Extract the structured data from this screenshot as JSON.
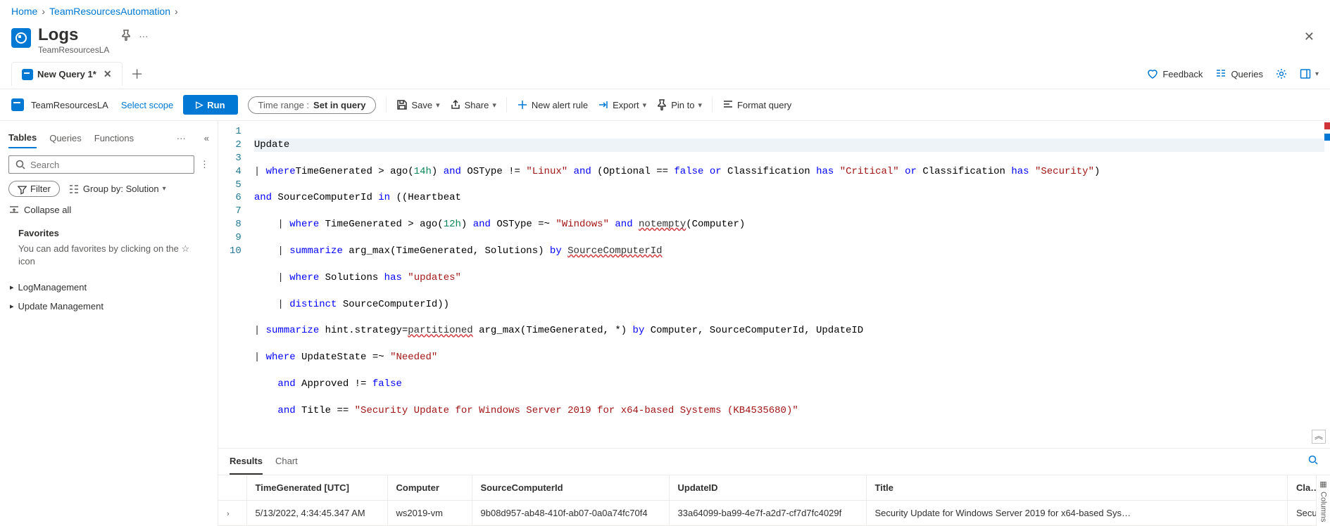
{
  "breadcrumb": {
    "home": "Home",
    "resource": "TeamResourcesAutomation"
  },
  "header": {
    "title": "Logs",
    "subtitle": "TeamResourcesLA"
  },
  "queryTabs": {
    "active": "New Query 1*"
  },
  "topRight": {
    "feedback": "Feedback",
    "queries": "Queries"
  },
  "toolbar": {
    "scopeName": "TeamResourcesLA",
    "selectScope": "Select scope",
    "run": "Run",
    "timeRangeLabel": "Time range :",
    "timeRangeValue": "Set in query",
    "save": "Save",
    "share": "Share",
    "newAlert": "New alert rule",
    "export": "Export",
    "pinTo": "Pin to",
    "formatQuery": "Format query"
  },
  "sidebar": {
    "tabs": [
      "Tables",
      "Queries",
      "Functions"
    ],
    "searchPlaceholder": "Search",
    "filter": "Filter",
    "groupBy": "Group by: Solution",
    "collapseAll": "Collapse all",
    "favoritesTitle": "Favorites",
    "favoritesHint": "You can add favorites by clicking on the ☆ icon",
    "tree": [
      "LogManagement",
      "Update Management"
    ]
  },
  "editor": {
    "lineNumbers": [
      "1",
      "2",
      "3",
      "4",
      "5",
      "6",
      "7",
      "8",
      "9",
      "10"
    ]
  },
  "results": {
    "tabs": [
      "Results",
      "Chart"
    ],
    "columns": [
      "TimeGenerated [UTC]",
      "Computer",
      "SourceComputerId",
      "UpdateID",
      "Title",
      "Classification"
    ],
    "rows": [
      {
        "TimeGenerated": "5/13/2022, 4:34:45.347 AM",
        "Computer": "ws2019-vm",
        "SourceComputerId": "9b08d957-ab48-410f-ab07-0a0a74fc70f4",
        "UpdateID": "33a64099-ba99-4e7f-a2d7-cf7d7fc4029f",
        "Title": "Security Update for Windows Server 2019 for x64-based Sys…",
        "Classification": "Secu"
      }
    ],
    "columnsHandle": "Columns"
  },
  "queryText": {
    "l1": "Update",
    "l2": {
      "where": "where",
      "f1": "TimeGenerated > ago(",
      "t1": "14h",
      "f2": ") ",
      "and1": "and",
      "f3": " OSType != ",
      "s1": "\"Linux\"",
      "sp1": " ",
      "and2": "and",
      "f4": " (Optional == ",
      "false1": "false",
      "sp2": " ",
      "or1": "or",
      "f5": " Classification ",
      "has1": "has",
      "sp3": " ",
      "s2": "\"Critical\"",
      "sp4": " ",
      "or2": "or",
      "f6": " Classification ",
      "has2": "has",
      "sp5": " ",
      "s3": "\"Security\"",
      "f7": ")"
    },
    "l2b": {
      "and": "and",
      "rest": " SourceComputerId ",
      "in": "in",
      "paren": " ((Heartbeat"
    },
    "l3": {
      "where": "where",
      "f1": " TimeGenerated > ago(",
      "t1": "12h",
      "f2": ") ",
      "and": "and",
      "f3": " OSType =~ ",
      "s1": "\"Windows\"",
      "sp": " ",
      "and2": "and",
      "sp2": " ",
      "fn": "notempty",
      "f4": "(Computer)"
    },
    "l4": {
      "sum": "summarize",
      "rest": " arg_max(TimeGenerated, Solutions) ",
      "by": "by",
      "sp": " ",
      "sci": "SourceComputerId"
    },
    "l5": {
      "where": "where",
      "rest": " Solutions ",
      "has": "has",
      "sp": " ",
      "s1": "\"updates\""
    },
    "l6": {
      "dist": "distinct",
      "rest": " SourceComputerId))"
    },
    "l7": {
      "sum": "summarize",
      "rest1": " hint.strategy=",
      "part": "partitioned",
      "rest2": " arg_max(TimeGenerated, *) ",
      "by": "by",
      "rest3": " Computer, SourceComputerId, UpdateID"
    },
    "l8": {
      "where": "where",
      "rest": " UpdateState =~ ",
      "s1": "\"Needed\""
    },
    "l9": {
      "and": "and",
      "rest": " Approved != ",
      "false1": "false"
    },
    "l10": {
      "and": "and",
      "rest": " Title == ",
      "s1": "\"Security Update for Windows Server 2019 for x64-based Systems (KB4535680)\""
    }
  }
}
